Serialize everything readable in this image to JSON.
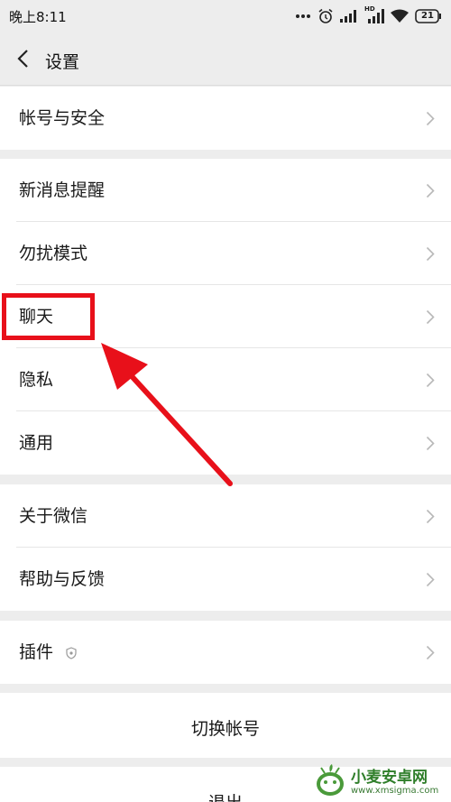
{
  "status_bar": {
    "time": "晚上8:11",
    "icons": [
      "more-dots-icon",
      "alarm-icon",
      "signal-icon",
      "hd-signal-icon",
      "wifi-icon",
      "battery-icon"
    ],
    "hd_label": "HD",
    "battery": "21"
  },
  "nav": {
    "back_icon": "chevron-left-icon",
    "title": "设置"
  },
  "groups": [
    {
      "items": [
        {
          "label": "帐号与安全"
        }
      ]
    },
    {
      "items": [
        {
          "label": "新消息提醒"
        },
        {
          "label": "勿扰模式"
        },
        {
          "label": "聊天"
        },
        {
          "label": "隐私"
        },
        {
          "label": "通用"
        }
      ]
    },
    {
      "items": [
        {
          "label": "关于微信"
        },
        {
          "label": "帮助与反馈"
        }
      ]
    },
    {
      "items": [
        {
          "label": "插件",
          "badge_icon": "plugin-shield-icon"
        }
      ]
    }
  ],
  "actions": {
    "switch_account": "切换帐号",
    "logout": "退出"
  },
  "annotation": {
    "color": "#e8101a",
    "target": "聊天"
  },
  "watermark": {
    "title": "小麦安卓网",
    "url": "www.xmsigma.com"
  },
  "colors": {
    "background": "#ededed",
    "card": "#ffffff",
    "chevron": "#b8b8b8",
    "highlight": "#e8101a"
  }
}
